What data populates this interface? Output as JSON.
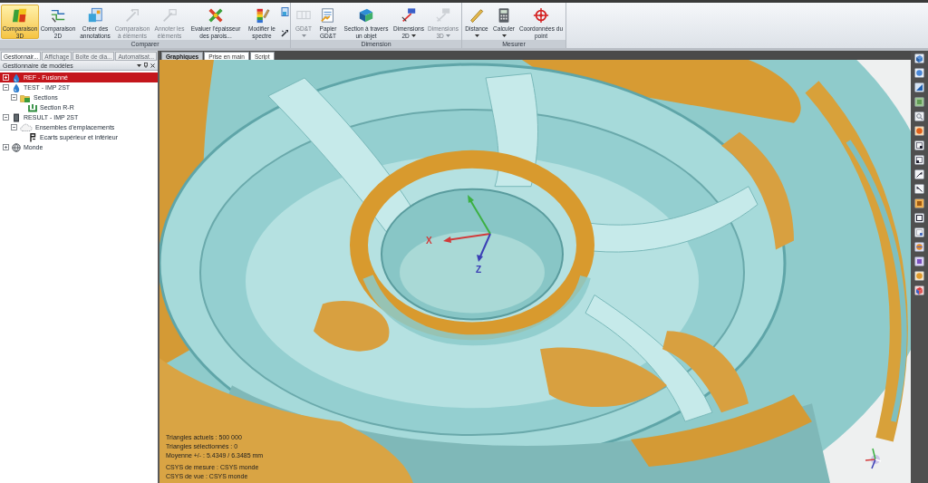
{
  "ribbon": {
    "groups": [
      {
        "label": "Comparer",
        "buttons": [
          {
            "label": "Comparaison 3D",
            "selected": true,
            "disabled": false,
            "dropdown": false
          },
          {
            "label": "Comparaison 2D",
            "selected": false,
            "disabled": false,
            "dropdown": false
          },
          {
            "label": "Créer des annotations",
            "selected": false,
            "disabled": false,
            "dropdown": false
          },
          {
            "label": "Comparaison à éléments",
            "selected": false,
            "disabled": true,
            "dropdown": false
          },
          {
            "label": "Annoter les éléments",
            "selected": false,
            "disabled": true,
            "dropdown": false
          },
          {
            "label": "Evaluer l'épaisseur des parois...",
            "selected": false,
            "disabled": false,
            "dropdown": false
          },
          {
            "label": "Modifier le spectre",
            "selected": false,
            "disabled": false,
            "dropdown": false
          }
        ]
      },
      {
        "label": "Dimension",
        "buttons": [
          {
            "label": "GD&T",
            "selected": false,
            "disabled": true,
            "dropdown": true
          },
          {
            "label": "Papier GD&T",
            "selected": false,
            "disabled": false,
            "dropdown": false
          },
          {
            "label": "Section à travers un objet",
            "selected": false,
            "disabled": false,
            "dropdown": false
          },
          {
            "label": "Dimensions 2D",
            "selected": false,
            "disabled": false,
            "dropdown": true
          },
          {
            "label": "Dimensions 3D",
            "selected": false,
            "disabled": true,
            "dropdown": true
          }
        ]
      },
      {
        "label": "Mesurer",
        "buttons": [
          {
            "label": "Distance",
            "selected": false,
            "disabled": false,
            "dropdown": true
          },
          {
            "label": "Calculer",
            "selected": false,
            "disabled": false,
            "dropdown": true
          },
          {
            "label": "Coordonnées du point",
            "selected": false,
            "disabled": false,
            "dropdown": false
          }
        ]
      }
    ]
  },
  "left_panel": {
    "tabs": [
      {
        "label": "Gestionnair...",
        "selected": true
      },
      {
        "label": "Affichage",
        "selected": false
      },
      {
        "label": "Boîte de dia...",
        "selected": false
      },
      {
        "label": "Automatisat...",
        "selected": false
      }
    ],
    "title": "Gestionnaire de modèles",
    "tree": [
      {
        "label": "REF - Fusionné",
        "kind": "mesh",
        "selected": true,
        "expanded": false
      },
      {
        "label": "TEST - IMP 2ST",
        "kind": "mesh",
        "selected": false,
        "expanded": true,
        "children": [
          {
            "label": "Sections",
            "kind": "folder",
            "selected": false,
            "expanded": true,
            "children": [
              {
                "label": "Section R-R",
                "kind": "section",
                "selected": false
              }
            ]
          }
        ]
      },
      {
        "label": "RESULT - IMP 2ST",
        "kind": "result",
        "selected": false,
        "expanded": true,
        "children": [
          {
            "label": "Ensembles d'emplacements",
            "kind": "set",
            "selected": false,
            "expanded": true,
            "children": [
              {
                "label": "Ecarts supérieur et inférieur",
                "kind": "deviation",
                "selected": false
              }
            ]
          }
        ]
      },
      {
        "label": "Monde",
        "kind": "world",
        "selected": false,
        "expanded": false
      }
    ]
  },
  "viewport": {
    "tabs": [
      {
        "label": "Graphiques",
        "selected": true
      },
      {
        "label": "Prise en main",
        "selected": false
      },
      {
        "label": "Script",
        "selected": false
      }
    ],
    "axis_labels": [
      {
        "text": "X",
        "color": "#d23a3a"
      },
      {
        "text": "Z",
        "color": "#3b3fb5"
      }
    ],
    "statistics": [
      "Triangles actuels : 500 000",
      "Triangles sélectionnés : 0",
      "Moyenne +/- : 5.4349 / 6.3485 mm"
    ],
    "coordinate_systems": [
      "CSYS de mesure : CSYS monde",
      "CSYS de vue : CSYS monde"
    ]
  }
}
